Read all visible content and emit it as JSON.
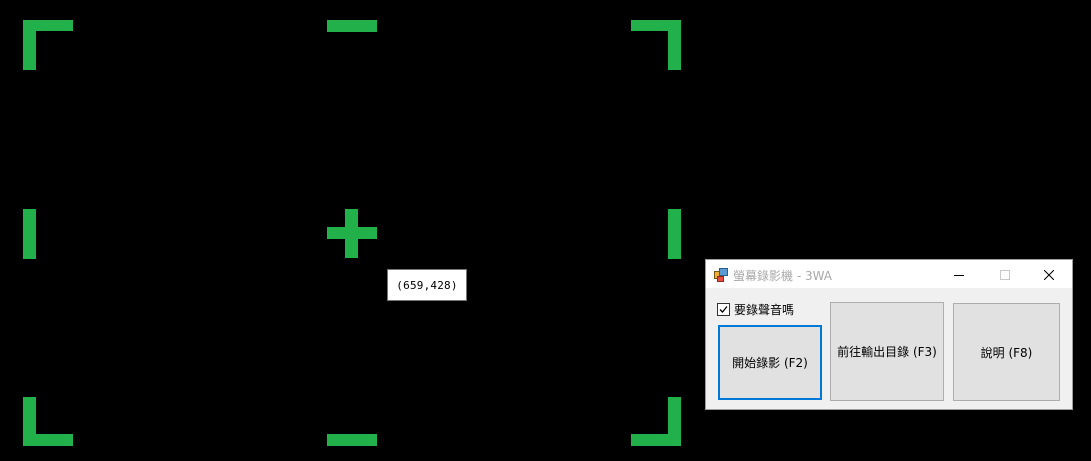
{
  "colors": {
    "accent": "#22b04a",
    "background": "#000000"
  },
  "cursor": {
    "coordinate_label": "(659,428)",
    "icon": "crosshair-icon"
  },
  "window": {
    "title": "螢幕錄影機 - 3WA",
    "icon": "app-icon",
    "minimize_icon": "minimize-icon",
    "maximize_icon": "maximize-icon",
    "close_icon": "close-icon",
    "record_audio": {
      "label": "要錄聲音嗎",
      "checked": true
    },
    "buttons": {
      "start_label": "開始錄影 (F2)",
      "output_dir_label": "前往輸出目錄 (F3)",
      "help_label": "說明 (F8)"
    }
  }
}
